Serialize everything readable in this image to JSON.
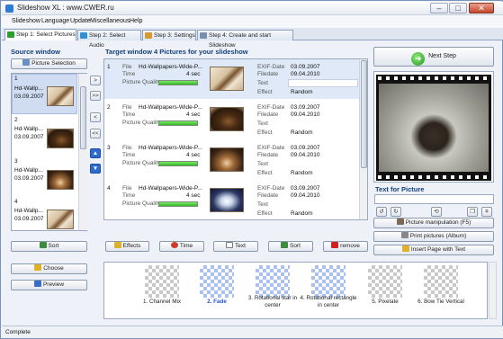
{
  "window": {
    "title": "Slideshow XL : www.CWER.ru",
    "min": "–",
    "max": "□",
    "close": "✕"
  },
  "menu": [
    "Slideshow",
    "Language",
    "Update",
    "Miscellaneous",
    "Help"
  ],
  "tabs": [
    {
      "label": "Step 1: Select Pictures",
      "color": "#2d9e2d"
    },
    {
      "label": "Step 2: Select Audio",
      "color": "#2f8fd8"
    },
    {
      "label": "Step 3: Settings",
      "color": "#d89a2f"
    },
    {
      "label": "Step 4: Create and start Slideshow",
      "color": "#7a8fb0"
    }
  ],
  "source": {
    "title": "Source window",
    "picture_selection": "Picture Selection",
    "items": [
      {
        "num": "1",
        "name": "Hd-Wallp...",
        "date": "03.09.2007"
      },
      {
        "num": "2",
        "name": "Hd-Wallp...",
        "date": "03.09.2007"
      },
      {
        "num": "3",
        "name": "Hd-Wallp...",
        "date": "03.09.2007"
      },
      {
        "num": "4",
        "name": "Hd-Wallp...",
        "date": "03.09.2007"
      }
    ],
    "sort": "Sort",
    "choose": "Choose",
    "preview": "Preview"
  },
  "transfer": {
    "add_one": ">",
    "add_all": ">>",
    "remove_one": "<",
    "remove_all": "<<"
  },
  "target": {
    "title": "Target window 4 Pictures for your slideshow",
    "labels": {
      "file": "File",
      "time": "Time",
      "quality": "Picture Quality",
      "exif": "EXIF-Date",
      "filedate": "Filedate",
      "text": "Text",
      "effect": "Effect"
    },
    "items": [
      {
        "num": "1",
        "file": "Hd-Wallpapers-Wide-P...",
        "time": "4 sec",
        "quality": 1.0,
        "exif": "03.09.2007",
        "filedate": "09.04.2010",
        "text": "",
        "effect": "Random"
      },
      {
        "num": "2",
        "file": "Hd-Wallpapers-Wide-P...",
        "time": "4 sec",
        "quality": 1.0,
        "exif": "03.09.2007",
        "filedate": "09.04.2010",
        "text": "",
        "effect": "Random"
      },
      {
        "num": "3",
        "file": "Hd-Wallpapers-Wide-P...",
        "time": "4 sec",
        "quality": 1.0,
        "exif": "03.09.2007",
        "filedate": "09.04.2010",
        "text": "",
        "effect": "Random"
      },
      {
        "num": "4",
        "file": "Hd-Wallpapers-Wide-P...",
        "time": "4 sec",
        "quality": 1.0,
        "exif": "03.09.2007",
        "filedate": "09.04.2010",
        "text": "",
        "effect": "Random"
      }
    ],
    "buttons": {
      "effects": "Effects",
      "time": "Time",
      "text": "Text",
      "sort": "Sort",
      "remove": "remove"
    }
  },
  "right": {
    "next_step": "Next Step",
    "text_for_picture": "Text for Picture",
    "manipulation": "Picture manipulation (F5)",
    "print": "Print pictures (Album)",
    "insert": "Insert Page with Text"
  },
  "transitions": [
    {
      "label": "1. Channel Mix",
      "selected": false
    },
    {
      "label": "2. Fade",
      "selected": true
    },
    {
      "label": "3. Rotational star in center",
      "selected": false
    },
    {
      "label": "4. Rotational rectangle in center",
      "selected": false
    },
    {
      "label": "5. Pixelate",
      "selected": false
    },
    {
      "label": "6. Bow Tie Vertical",
      "selected": false
    }
  ],
  "status": "Complete"
}
